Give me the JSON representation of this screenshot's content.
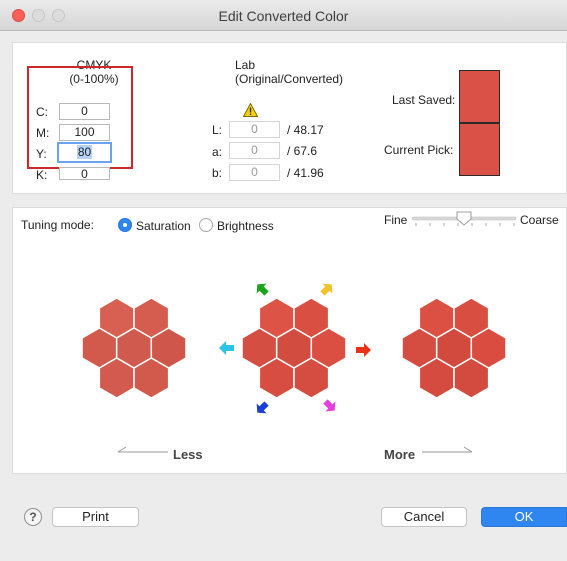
{
  "window": {
    "title": "Edit Converted Color"
  },
  "cmyk": {
    "header_line1": "CMYK",
    "header_line2": "(0-100%)",
    "c_label": "C:",
    "c_value": "0",
    "m_label": "M:",
    "m_value": "100",
    "y_label": "Y:",
    "y_value": "80",
    "k_label": "K:",
    "k_value": "0"
  },
  "lab": {
    "header_line1": "Lab",
    "header_line2": "(Original/Converted)",
    "l_label": "L:",
    "l_value": "0",
    "l_converted": "/ 48.17",
    "a_label": "a:",
    "a_value": "0",
    "a_converted": "/ 67.6",
    "b_label": "b:",
    "b_value": "0",
    "b_converted": "/ 41.96"
  },
  "swatches": {
    "last_saved_label": "Last Saved:",
    "current_pick_label": "Current Pick:",
    "color": "#d95147"
  },
  "tuning": {
    "mode_label": "Tuning mode:",
    "saturation_label": "Saturation",
    "brightness_label": "Brightness",
    "fine_label": "Fine",
    "coarse_label": "Coarse",
    "less_label": "Less",
    "more_label": "More"
  },
  "hex_colors": {
    "less": [
      "#d86052",
      "#d45d4f",
      "#d25a4d",
      "#d05a4d",
      "#cf564a",
      "#d35a4e",
      "#d15a4c"
    ],
    "center": [
      "#dd5447",
      "#d94f42",
      "#d44e42",
      "#d24c40",
      "#db4f43",
      "#d84d41",
      "#d54c40"
    ],
    "more": [
      "#dc4f43",
      "#d84e41",
      "#d54c40",
      "#d24a3e",
      "#da4c40",
      "#d64b3f",
      "#d34a3e"
    ]
  },
  "arrows": {
    "green": "#1aa51a",
    "yellow": "#f2c12c",
    "cyan": "#2bc3e8",
    "red": "#e8321a",
    "blue": "#1a3fd6",
    "magenta": "#e53fe0"
  },
  "buttons": {
    "help": "?",
    "print": "Print",
    "cancel": "Cancel",
    "ok": "OK"
  }
}
